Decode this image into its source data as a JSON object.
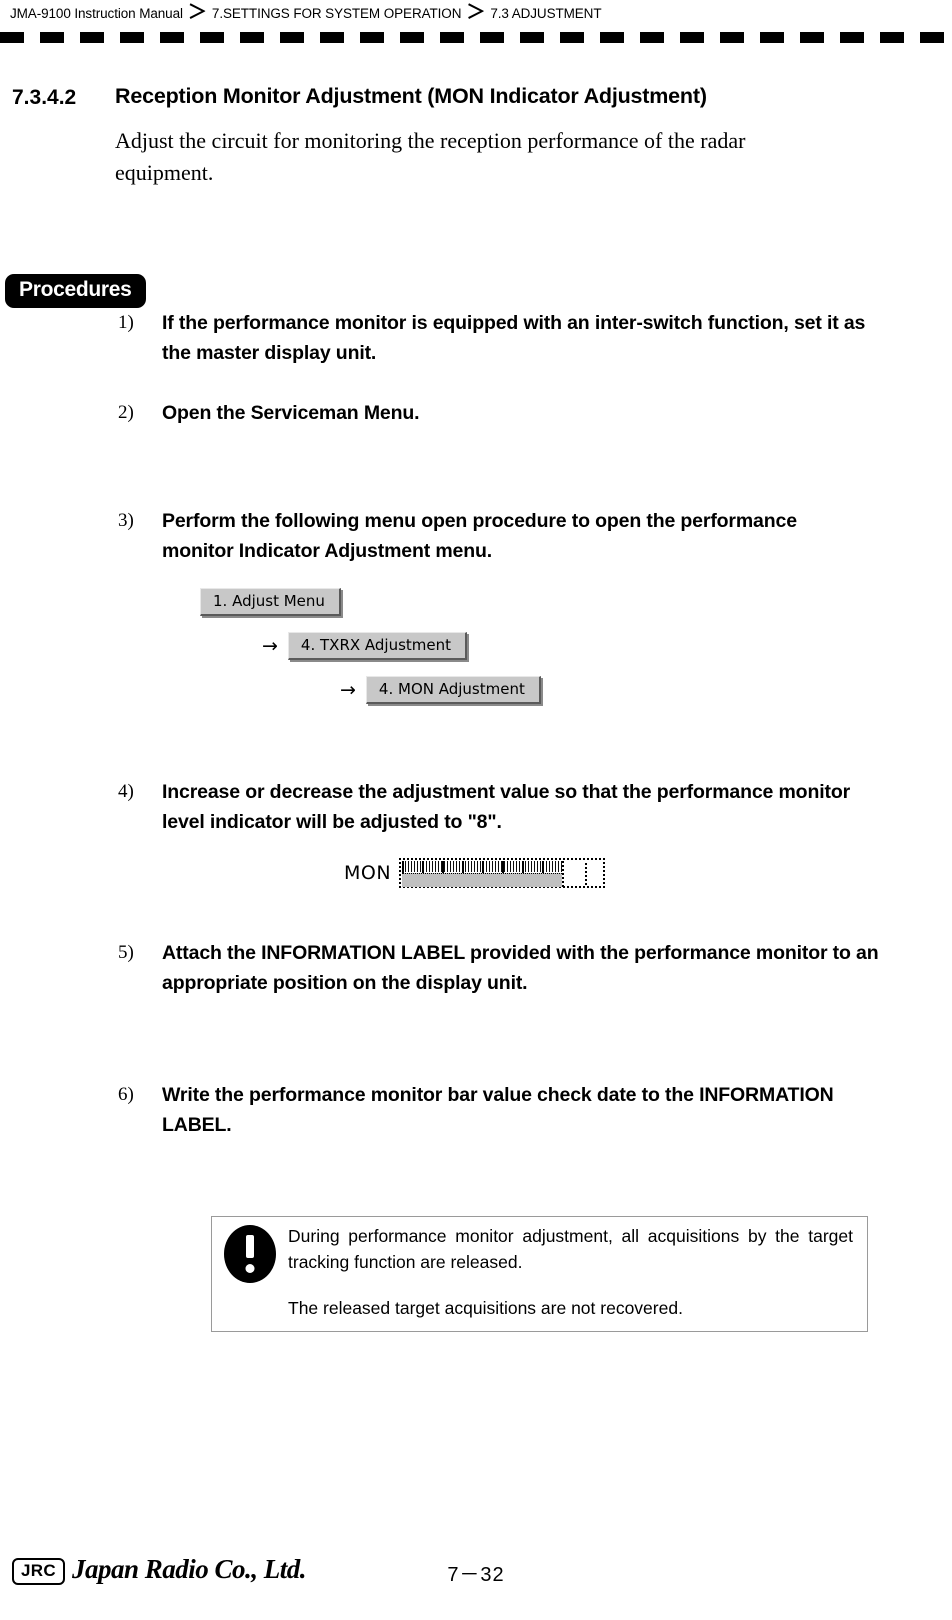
{
  "header": {
    "manual": "JMA-9100 Instruction Manual",
    "separator": "＞",
    "chapter": "7.SETTINGS FOR SYSTEM OPERATION",
    "section": "7.3  ADJUSTMENT"
  },
  "section": {
    "number": "7.3.4.2",
    "title": "Reception Monitor Adjustment (MON Indicator Adjustment)",
    "intro": "Adjust the circuit for monitoring the reception performance of the radar equipment."
  },
  "procedures": {
    "badge": "Procedures",
    "steps": [
      {
        "marker": "1)",
        "text": "If the performance monitor is equipped with an inter-switch function, set it as the master display unit."
      },
      {
        "marker": "2)",
        "text": "Open the Serviceman Menu."
      },
      {
        "marker": "3)",
        "text": "Perform the following menu open procedure to open the performance monitor Indicator Adjustment menu."
      },
      {
        "marker": "4)",
        "text": "Increase or decrease the adjustment value so that the performance monitor level indicator will be adjusted to \"8\"."
      },
      {
        "marker": "5)",
        "text": "Attach the INFORMATION LABEL provided with the performance monitor to an appropriate position on the display unit."
      },
      {
        "marker": "6)",
        "text": "Write the performance monitor bar value check date to the INFORMATION LABEL."
      }
    ]
  },
  "menu_chain": {
    "arrow": "→",
    "items": [
      {
        "label": "1. Adjust Menu"
      },
      {
        "label": "4. TXRX Adjustment"
      },
      {
        "label": "4. MON Adjustment"
      }
    ]
  },
  "mon_indicator": {
    "label": "MON",
    "target_value": "8"
  },
  "caution": {
    "icon": "exclamation-icon",
    "line1": "During performance monitor adjustment, all acquisitions by the target tracking function are released.",
    "line2": "The released target acquisitions are not recovered."
  },
  "footer": {
    "logo": "JRC",
    "company": "Japan Radio Co., Ltd.",
    "page": "7－32"
  }
}
